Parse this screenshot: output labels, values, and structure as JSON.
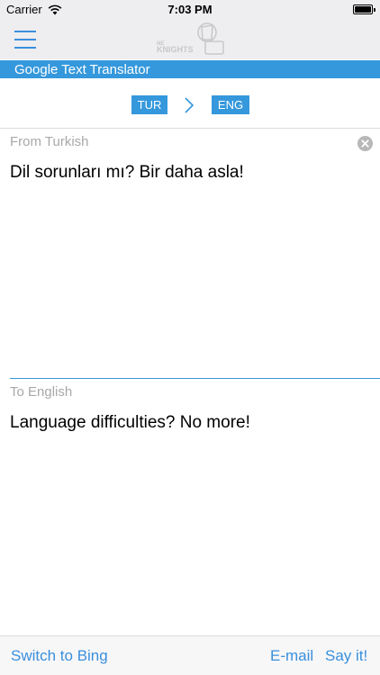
{
  "status_bar": {
    "carrier": "Carrier",
    "time": "7:03 PM"
  },
  "nav": {
    "logo_text": "KNIGHTS"
  },
  "header": {
    "title": "Google Text Translator"
  },
  "languages": {
    "source": "TUR",
    "target": "ENG"
  },
  "input": {
    "label": "From Turkish",
    "text": "Dil sorunları mı? Bir daha asla!"
  },
  "output": {
    "label": "To English",
    "text": "Language difficulties? No more!"
  },
  "toolbar": {
    "switch_label": "Switch to Bing",
    "email_label": "E-mail",
    "say_label": "Say it!"
  },
  "colors": {
    "accent": "#3598dc",
    "link": "#3a8fdc",
    "label_gray": "#a8a8a8"
  }
}
